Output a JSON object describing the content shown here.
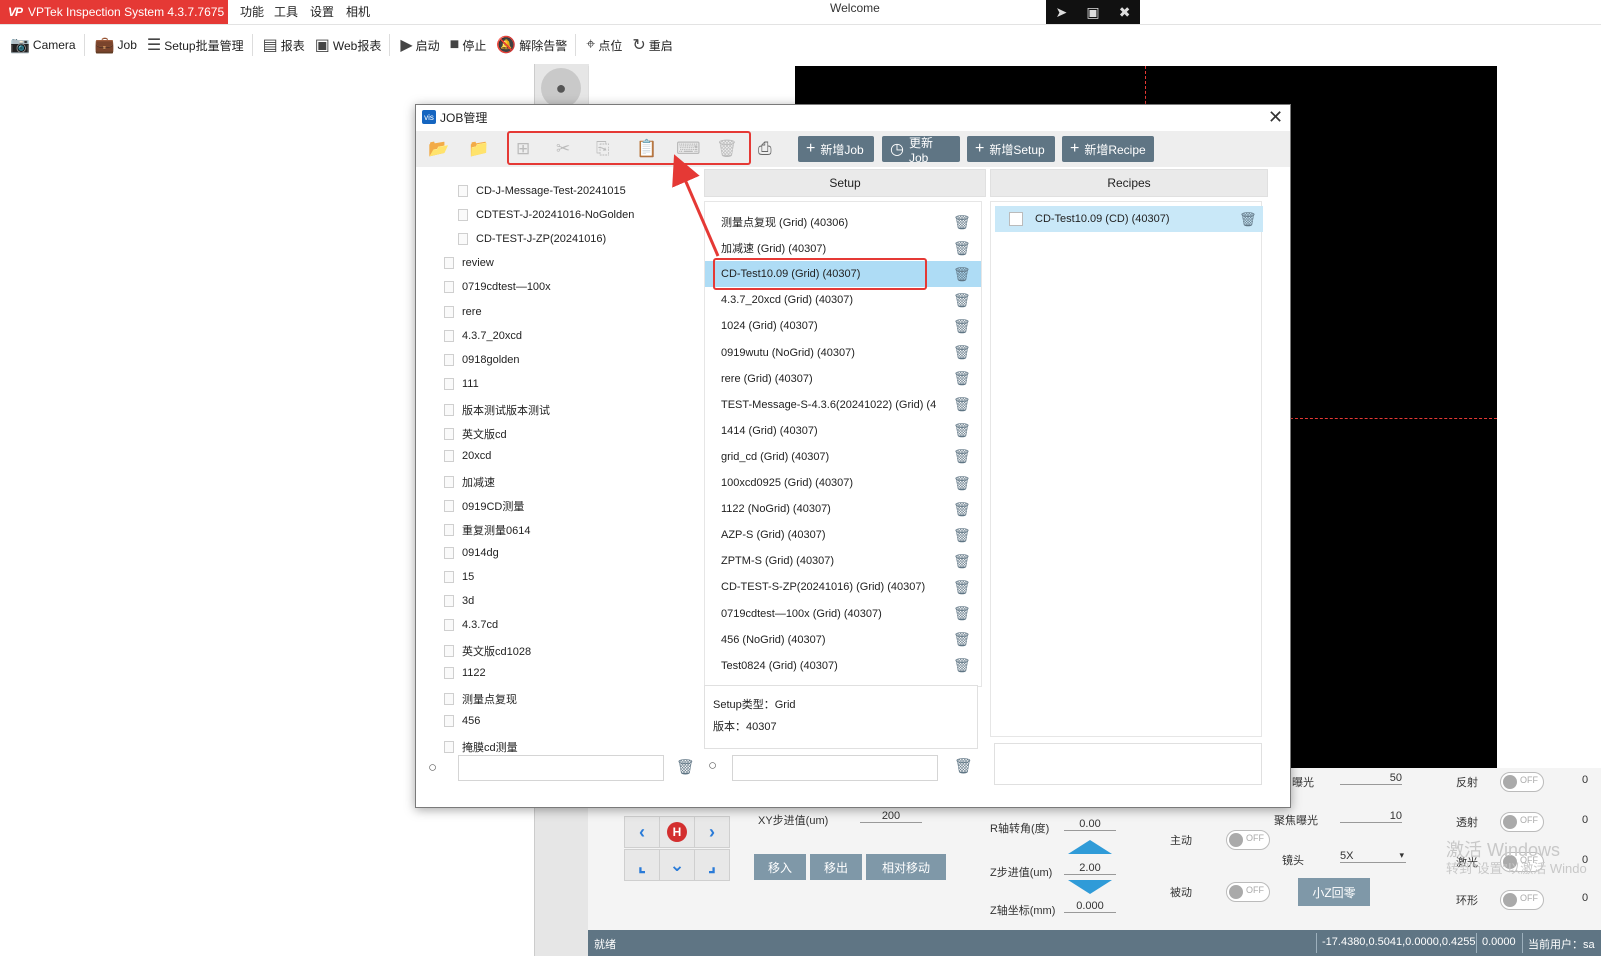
{
  "app": {
    "title": "VPTek Inspection System 4.3.7.7675",
    "brand_color": "#e53935",
    "menu": [
      "功能",
      "工具",
      "设置",
      "相机"
    ],
    "welcome": "Welcome"
  },
  "toolbar": {
    "items": [
      {
        "label": "Camera",
        "icon": "camera-icon"
      },
      {
        "label": "Job",
        "icon": "briefcase-icon"
      },
      {
        "label": "Setup批量管理",
        "icon": "list-check-icon"
      },
      {
        "label": "报表",
        "icon": "report-icon"
      },
      {
        "label": "Web报表",
        "icon": "web-report-icon"
      },
      {
        "label": "启动",
        "icon": "play-icon"
      },
      {
        "label": "停止",
        "icon": "stop-icon"
      },
      {
        "label": "解除告警",
        "icon": "bell-off-icon"
      },
      {
        "label": "点位",
        "icon": "location-pin-icon"
      },
      {
        "label": "重启",
        "icon": "restart-icon"
      }
    ]
  },
  "dialog": {
    "title": "JOB管理",
    "buttons": {
      "new_job": "新增Job",
      "update_job": "更新Job",
      "new_setup": "新增Setup",
      "new_recipe": "新增Recipe"
    },
    "tree": [
      {
        "label": "CD-J-Message-Test-20241015",
        "level": 2
      },
      {
        "label": "CDTEST-J-20241016-NoGolden",
        "level": 2
      },
      {
        "label": "CD-TEST-J-ZP(20241016)",
        "level": 2
      },
      {
        "label": "review",
        "level": 1
      },
      {
        "label": "0719cdtest—100x",
        "level": 1
      },
      {
        "label": "rere",
        "level": 1
      },
      {
        "label": "4.3.7_20xcd",
        "level": 1
      },
      {
        "label": "0918golden",
        "level": 1
      },
      {
        "label": "111",
        "level": 1
      },
      {
        "label": "版本测试版本测试",
        "level": 1
      },
      {
        "label": "英文版cd",
        "level": 1
      },
      {
        "label": "20xcd",
        "level": 1
      },
      {
        "label": "加减速",
        "level": 1
      },
      {
        "label": "0919CD测量",
        "level": 1
      },
      {
        "label": "重复测量0614",
        "level": 1
      },
      {
        "label": "0914dg",
        "level": 1
      },
      {
        "label": "15",
        "level": 1
      },
      {
        "label": "3d",
        "level": 1
      },
      {
        "label": "4.3.7cd",
        "level": 1
      },
      {
        "label": "英文版cd1028",
        "level": 1
      },
      {
        "label": "1122",
        "level": 1
      },
      {
        "label": "测量点复现",
        "level": 1
      },
      {
        "label": "456",
        "level": 1
      },
      {
        "label": "掩膜cd测量",
        "level": 1
      }
    ],
    "setup": {
      "header": "Setup",
      "items": [
        "测量点复现 (Grid) (40306)",
        "加减速 (Grid) (40307)",
        "CD-Test10.09 (Grid) (40307)",
        "4.3.7_20xcd (Grid) (40307)",
        "1024 (Grid) (40307)",
        "0919wutu (NoGrid) (40307)",
        "rere (Grid) (40307)",
        "TEST-Message-S-4.3.6(20241022) (Grid) (4",
        "1414 (Grid) (40307)",
        "grid_cd (Grid) (40307)",
        "100xcd0925 (Grid) (40307)",
        "1122 (NoGrid) (40307)",
        "AZP-S (Grid) (40307)",
        "ZPTM-S (Grid) (40307)",
        "CD-TEST-S-ZP(20241016) (Grid) (40307)",
        "0719cdtest—100x (Grid) (40307)",
        "456 (NoGrid) (40307)",
        "Test0824 (Grid) (40307)"
      ],
      "selected_index": 2,
      "info_type": "Setup类型：Grid",
      "info_version": "版本：40307"
    },
    "recipes": {
      "header": "Recipes",
      "items": [
        "CD-Test10.09 (CD) (40307)"
      ]
    }
  },
  "controls": {
    "xy_step_label": "XY步进值(um)",
    "xy_step_value": "200",
    "move_in": "移入",
    "move_out": "移出",
    "relative_move": "相对移动",
    "r_angle_label": "R轴转角(度)",
    "r_angle_value": "0.00",
    "z_step_label": "Z步进值(um)",
    "z_step_value": "2.00",
    "z_coord_label": "Z轴坐标(mm)",
    "z_coord_value": "0.000",
    "exposure_label": "曝光",
    "exposure_value": "50",
    "focus_exposure_label": "聚焦曝光",
    "focus_exposure_value": "10",
    "active_label": "主动",
    "passive_label": "被动",
    "lens_label": "镜头",
    "lens_value": "5X",
    "laser_label": "激光",
    "small_z_zero": "小Z回零",
    "reflect_label": "反射",
    "transmit_label": "透射",
    "ring_label": "环形",
    "toggle_off": "OFF",
    "home_letter": "H",
    "right_value_1": "0",
    "right_value_2": "0",
    "right_value_3": "0",
    "right_value_4": "0"
  },
  "watermark": {
    "line1": "激活 Windows",
    "line2": "转到\"设置\"以激活 Windo"
  },
  "status": {
    "state": "就绪",
    "coords": "-17.4380,0.5041,0.0000,0.4255",
    "value": "0.0000",
    "user": "当前用户：sa"
  }
}
